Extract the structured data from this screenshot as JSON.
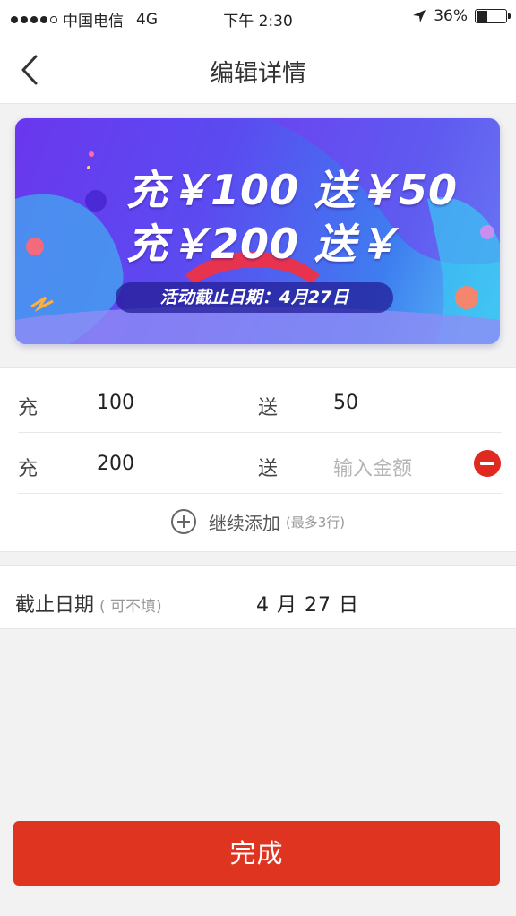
{
  "status_bar": {
    "carrier": "中国电信",
    "network": "4G",
    "time": "下午 2:30",
    "battery": "36%",
    "battery_level": 0.36
  },
  "header": {
    "title": "编辑详情",
    "back_icon": "chevron-left-icon"
  },
  "banner": {
    "line1": "充￥100 送￥50",
    "line2": "充￥200 送￥",
    "deadline": "活动截止日期：4月27日"
  },
  "rules": {
    "rows": [
      {
        "charge_label": "充",
        "charge_value": "100",
        "bonus_label": "送",
        "bonus_value": "50",
        "bonus_placeholder": ""
      },
      {
        "charge_label": "充",
        "charge_value": "200",
        "bonus_label": "送",
        "bonus_value": "",
        "bonus_placeholder": "输入金额"
      }
    ],
    "add_label": "继续添加",
    "add_hint": "(最多3行)",
    "remove_icon": "minus-circle-icon",
    "add_icon": "plus-circle-icon"
  },
  "deadline": {
    "label": "截止日期",
    "optional": "( 可不填)",
    "value": "4 月 27 日"
  },
  "footer": {
    "done_label": "完成"
  },
  "colors": {
    "accent_red": "#df3420",
    "banner_purple": "#6a37ee",
    "banner_blue": "#5ac3f5"
  }
}
